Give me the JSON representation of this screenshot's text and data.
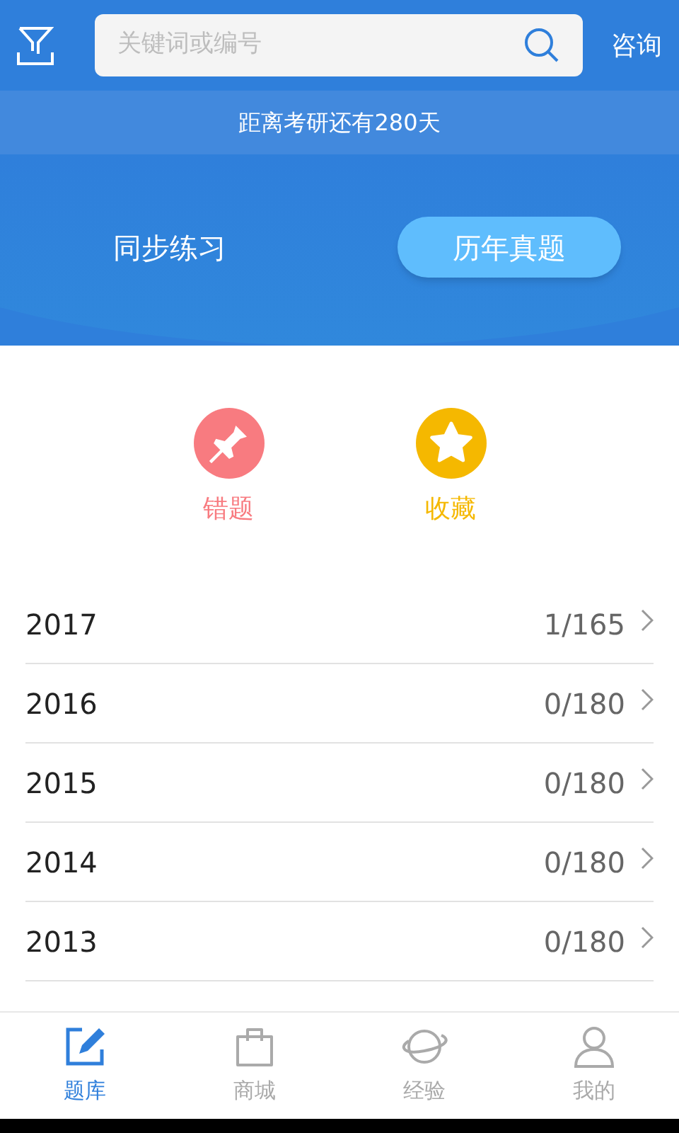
{
  "header": {
    "search": {
      "placeholder": "关键词或编号"
    },
    "consult": "咨询"
  },
  "countdown": "距离考研还有280天",
  "tabs": [
    {
      "label": "同步练习",
      "selected": false
    },
    {
      "label": "历年真题",
      "selected": true
    }
  ],
  "shortcuts": [
    {
      "kind": "pin",
      "label": "错题",
      "color": "#f87b80"
    },
    {
      "kind": "star",
      "label": "收藏",
      "color": "#f5b800"
    }
  ],
  "years": [
    {
      "year": "2017",
      "progress": "1/165"
    },
    {
      "year": "2016",
      "progress": "0/180"
    },
    {
      "year": "2015",
      "progress": "0/180"
    },
    {
      "year": "2014",
      "progress": "0/180"
    },
    {
      "year": "2013",
      "progress": "0/180"
    }
  ],
  "nav": [
    {
      "kind": "edit",
      "label": "题库",
      "selected": true
    },
    {
      "kind": "bag",
      "label": "商城",
      "selected": false
    },
    {
      "kind": "planet",
      "label": "经验",
      "selected": false
    },
    {
      "kind": "user",
      "label": "我的",
      "selected": false
    }
  ]
}
